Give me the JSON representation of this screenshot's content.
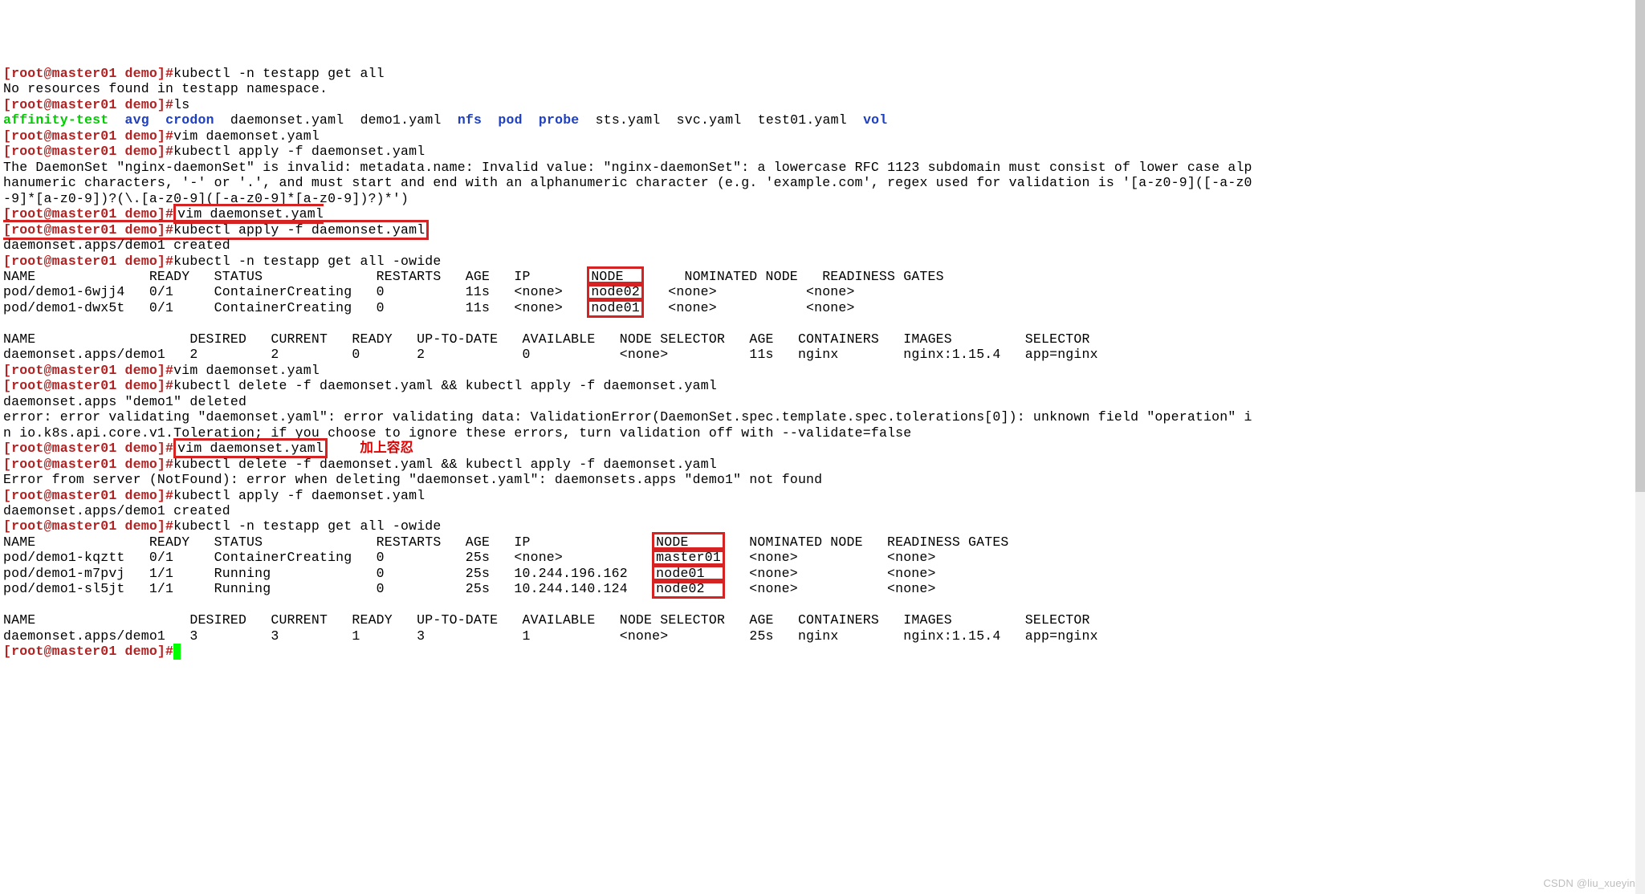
{
  "prompt": "[root@master01 demo]#",
  "lines": {
    "cmd_getall": "kubectl -n testapp get all",
    "no_res": "No resources found in testapp namespace.",
    "cmd_ls": "ls",
    "ls": {
      "affinity": "affinity-test",
      "avg": "avg",
      "crodon": "crodon",
      "daemonset": "daemonset.yaml",
      "demo1": "demo1.yaml",
      "nfs": "nfs",
      "pod": "pod",
      "probe": "probe",
      "sts": "sts.yaml",
      "svc": "svc.yaml",
      "test01": "test01.yaml",
      "vol": "vol"
    },
    "cmd_vim1": "vim daemonset.yaml",
    "cmd_apply1": "kubectl apply -f daemonset.yaml",
    "err1a": "The DaemonSet \"nginx-daemonSet\" is invalid: metadata.name: Invalid value: \"nginx-daemonSet\": a lowercase RFC 1123 subdomain must consist of lower case alp",
    "err1b": "hanumeric characters, '-' or '.', and must start and end with an alphanumeric character (e.g. 'example.com', regex used for validation is '[a-z0-9]([-a-z0",
    "err1c": "-9]*[a-z0-9])?(\\.[a-z0-9]([-a-z0-9]*[a-z0-9])?)*')",
    "cmd_vim2": "vim daemonset.yaml",
    "cmd_apply2": "kubectl apply -f daemonset.yaml",
    "created1": "daemonset.apps/demo1 created",
    "cmd_getowide1": "kubectl -n testapp get all -owide",
    "pods_hdr_a": "NAME              READY   STATUS              RESTARTS   AGE   IP       ",
    "pods_hdr_b": "NODE",
    "pods_hdr_c": "     NOMINATED NODE   READINESS GATES",
    "pod1a": "pod/demo1-6wjj4   0/1     ContainerCreating   0          11s   <none>   ",
    "pod1b": "node02",
    "pod1c": "   <none>           <none>",
    "pod2a": "pod/demo1-dwx5t   0/1     ContainerCreating   0          11s   <none>   ",
    "pod2b": "node01",
    "pod2c": "   <none>           <none>",
    "ds_hdr1": "NAME                   DESIRED   CURRENT   READY   UP-TO-DATE   AVAILABLE   NODE SELECTOR   AGE   CONTAINERS   IMAGES         SELECTOR",
    "ds_row1": "daemonset.apps/demo1   2         2         0       2            0           <none>          11s   nginx        nginx:1.15.4   app=nginx",
    "cmd_vim3": "vim daemonset.yaml",
    "cmd_delapp1": "kubectl delete -f daemonset.yaml && kubectl apply -f daemonset.yaml",
    "deleted": "daemonset.apps \"demo1\" deleted",
    "verr_a": "error: error validating \"daemonset.yaml\": error validating data: ValidationError(DaemonSet.spec.template.spec.tolerations[0]): unknown field \"operation\" i",
    "verr_b": "n io.k8s.api.core.v1.Toleration; if you choose to ignore these errors, turn validation off with --validate=false",
    "cmd_vim4": "vim daemonset.yaml",
    "ann": "    加上容忍",
    "cmd_delapp2": "kubectl delete -f daemonset.yaml && kubectl apply -f daemonset.yaml",
    "nf_err": "Error from server (NotFound): error when deleting \"daemonset.yaml\": daemonsets.apps \"demo1\" not found",
    "cmd_apply3": "kubectl apply -f daemonset.yaml",
    "created2": "daemonset.apps/demo1 created",
    "cmd_getowide2": "kubectl -n testapp get all -owide",
    "pods2_hdr_a": "NAME              READY   STATUS              RESTARTS   AGE   IP               ",
    "pods2_hdr_b": "NODE    ",
    "pods2_hdr_c": "   NOMINATED NODE   READINESS GATES",
    "p2r1a": "pod/demo1-kqztt   0/1     ContainerCreating   0          25s   <none>           ",
    "p2r1b": "master01",
    "p2r1c": "   <none>           <none>",
    "p2r2a": "pod/demo1-m7pvj   1/1     Running             0          25s   10.244.196.162   ",
    "p2r2b": "node01  ",
    "p2r2c": "   <none>           <none>",
    "p2r3a": "pod/demo1-sl5jt   1/1     Running             0          25s   10.244.140.124   ",
    "p2r3b": "node02  ",
    "p2r3c": "   <none>           <none>",
    "ds_hdr2": "NAME                   DESIRED   CURRENT   READY   UP-TO-DATE   AVAILABLE   NODE SELECTOR   AGE   CONTAINERS   IMAGES         SELECTOR",
    "ds_row2": "daemonset.apps/demo1   3         3         1       3            1           <none>          25s   nginx        nginx:1.15.4   app=nginx"
  },
  "footer": "CSDN @liu_xueyin"
}
